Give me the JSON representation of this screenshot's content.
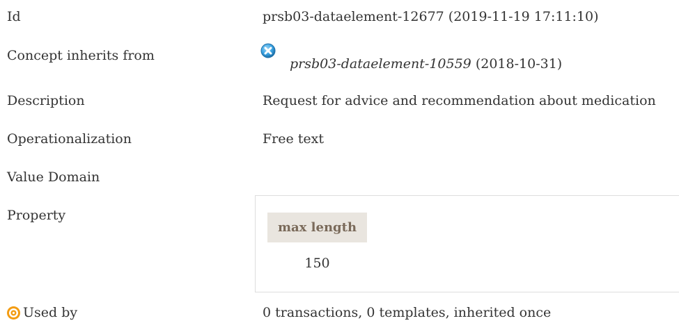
{
  "rows": {
    "id": {
      "label": "Id",
      "value": "prsb03-dataelement-12677 (2019-11-19 17:11:10)"
    },
    "inherits": {
      "label": "Concept inherits from",
      "link": "prsb03-dataelement-10559",
      "suffix": "(2018-10-31)"
    },
    "description": {
      "label": "Description",
      "value": "Request for advice and recommendation about medication"
    },
    "operationalization": {
      "label": "Operationalization",
      "value": "Free text"
    },
    "value_domain": {
      "label": "Value Domain"
    },
    "property": {
      "label": "Property",
      "header": "max length",
      "value": "150"
    },
    "used_by": {
      "label": "Used by",
      "value": "0 transactions, 0 templates, inherited once"
    }
  },
  "icons": {
    "inherits": "x-circle-icon",
    "used_by": "target-icon"
  },
  "colors": {
    "text": "#333333",
    "property_header_bg": "#e9e5df",
    "property_header_text": "#7a6a5a",
    "x_icon": "#3aa3e3",
    "target_icon": "#f39c12"
  }
}
